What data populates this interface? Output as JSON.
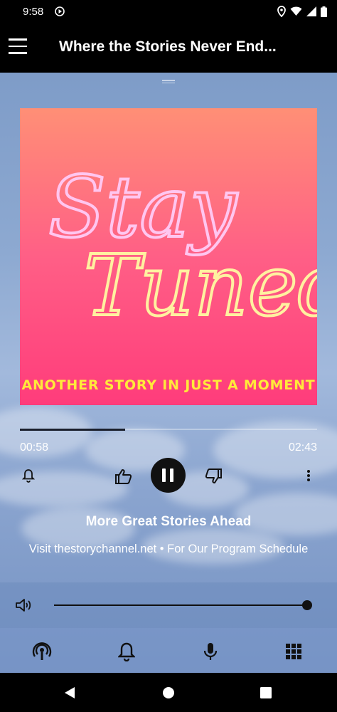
{
  "status_bar": {
    "time": "9:58",
    "icons": [
      "play-indicator-icon",
      "location-icon",
      "wifi-icon",
      "signal-icon",
      "battery-icon"
    ]
  },
  "app_bar": {
    "title": "Where the Stories Never End...",
    "menu_icon": "hamburger-menu-icon"
  },
  "artwork": {
    "caption": "ANOTHER STORY IN JUST A MOMENT",
    "script_line1": "Stay",
    "script_line2": "Tuned"
  },
  "playback": {
    "elapsed": "00:58",
    "total": "02:43",
    "progress": 0.355
  },
  "controls": [
    "alarm-icon",
    "thumbs-up-icon",
    "pause-icon",
    "thumbs-down-icon",
    "more-vert-icon"
  ],
  "track": {
    "title": "More Great Stories Ahead",
    "subtitle": "Visit thestorychannel.net • For Our Program Schedule"
  },
  "volume": {
    "level": 1.0
  },
  "bottom_nav": [
    "podcast-icon",
    "bell-icon",
    "microphone-icon",
    "grid-icon"
  ],
  "system_nav": [
    "back-icon",
    "home-icon",
    "recents-icon"
  ]
}
